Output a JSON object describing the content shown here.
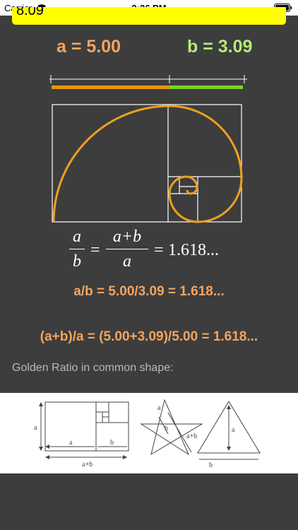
{
  "status_bar": {
    "carrier": "Carrier",
    "time": "2:26 PM"
  },
  "input_field": {
    "text": "8.09"
  },
  "values": {
    "a_label": "a = 5.00",
    "b_label": "b = 3.09",
    "a_color": "#f4a460",
    "b_color": "#b7e97a",
    "bar_a_color": "#e8950c",
    "bar_b_color": "#7ed321",
    "spiral_color": "#f0a020"
  },
  "formula": {
    "num1": "a",
    "den1": "b",
    "num2": "a+b",
    "den2": "a",
    "eq1": "=",
    "eq2": "=",
    "result": "1.618..."
  },
  "ratio_line_1": "a/b = 5.00/3.09 = 1.618...",
  "ratio_line_2": "(a+b)/a = (5.00+3.09)/5.00 = 1.618...",
  "caption": "Golden Ratio in common shape:",
  "shapes": {
    "rect_a": "a",
    "rect_bottom_a": "a",
    "rect_bottom_b": "b",
    "rect_sum": "a+b",
    "star_a": "a",
    "star_b": "b",
    "star_sum": "a+b",
    "tri_a": "a",
    "tri_b": "b"
  }
}
